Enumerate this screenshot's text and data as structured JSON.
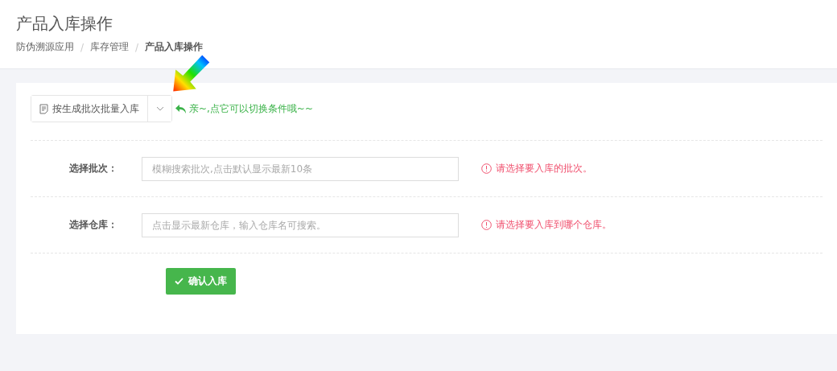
{
  "page_title": "产品入库操作",
  "breadcrumb": {
    "separator": "/",
    "items": [
      {
        "label": "防伪溯源应用",
        "current": false
      },
      {
        "label": "库存管理",
        "current": false
      },
      {
        "label": "产品入库操作",
        "current": true
      }
    ]
  },
  "mode_switch": {
    "label": "按生成批次批量入库",
    "hint": "亲~,点它可以切换条件哦~~"
  },
  "fields": [
    {
      "label": "选择批次：",
      "placeholder": "模糊搜索批次,点击默认显示最新10条",
      "error": "请选择要入库的批次。"
    },
    {
      "label": "选择仓库：",
      "placeholder": "点击显示最新仓库，输入仓库名可搜索。",
      "error": "请选择要入库到哪个仓库。"
    }
  ],
  "submit": {
    "label": "确认入库"
  }
}
